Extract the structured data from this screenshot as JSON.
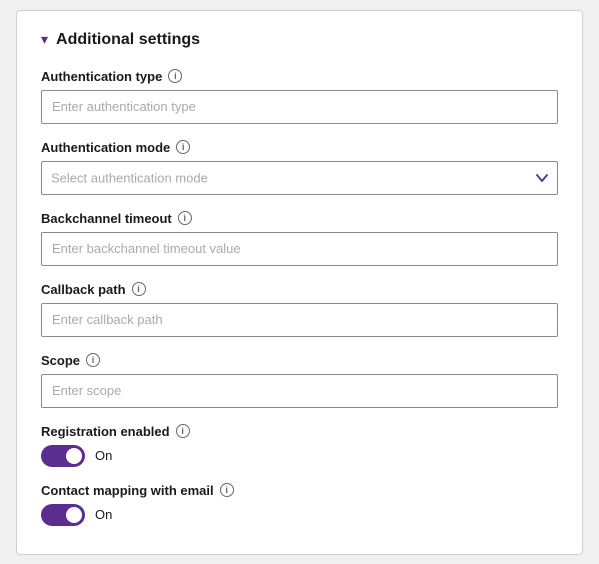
{
  "section": {
    "title": "Additional settings",
    "chevron": "▾"
  },
  "fields": {
    "authentication_type": {
      "label": "Authentication type",
      "placeholder": "Enter authentication type",
      "info": "i"
    },
    "authentication_mode": {
      "label": "Authentication mode",
      "placeholder": "Select authentication mode",
      "info": "i"
    },
    "backchannel_timeout": {
      "label": "Backchannel timeout",
      "placeholder": "Enter backchannel timeout value",
      "info": "i"
    },
    "callback_path": {
      "label": "Callback path",
      "placeholder": "Enter callback path",
      "info": "i"
    },
    "scope": {
      "label": "Scope",
      "placeholder": "Enter scope",
      "info": "i"
    },
    "registration_enabled": {
      "label": "Registration enabled",
      "info": "i",
      "toggle_value": "On",
      "enabled": true
    },
    "contact_mapping": {
      "label": "Contact mapping with email",
      "info": "i",
      "toggle_value": "On",
      "enabled": true
    }
  },
  "chevron_down": "⌄"
}
